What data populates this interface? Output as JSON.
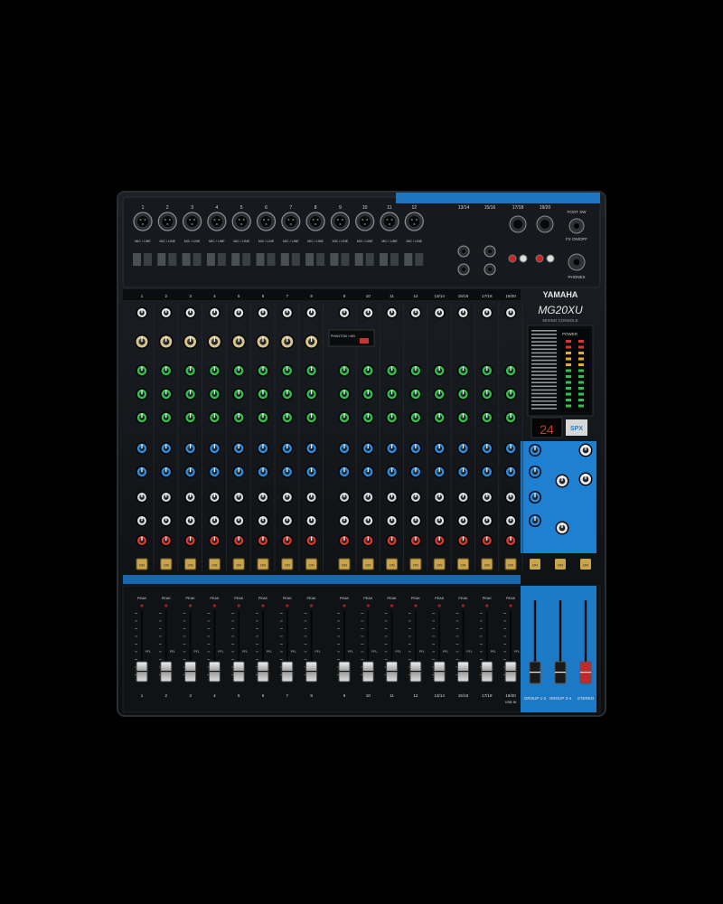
{
  "brand": "YAMAHA",
  "model": "MG20XU",
  "model_sub": "MIXING CONSOLE",
  "colors": {
    "background": "#000000",
    "body": "#111417",
    "accent_blue": "#1f7fd0",
    "knob_green": "#2ec24a",
    "knob_blue": "#2a8de0",
    "knob_red": "#e23a2a",
    "knob_cream": "#d9c48a",
    "on_button": "#c9a44a"
  },
  "top_labels": [
    "1",
    "2",
    "3",
    "4",
    "5",
    "6",
    "7",
    "8",
    "9",
    "10",
    "11",
    "12",
    "13/14",
    "15/16",
    "17/18",
    "19/20"
  ],
  "top_right": {
    "foot_sw": "FOOT SW",
    "fx_onoff": "FX ON/OFF",
    "phones": "PHONES"
  },
  "mic_line_label": "MIC / LINE",
  "channel_labels": [
    "1",
    "2",
    "3",
    "4",
    "5",
    "6",
    "7",
    "8",
    "9",
    "10",
    "11",
    "12",
    "13/14",
    "15/16",
    "17/18",
    "19/20"
  ],
  "phantom": "PHANTOM +48V",
  "on_label": "ON",
  "peak_label": "PEAK",
  "pfl_label": "PFL",
  "bottom_labels": [
    "1",
    "2",
    "3",
    "4",
    "5",
    "6",
    "7",
    "8",
    "9",
    "10",
    "11",
    "12",
    "13/14",
    "15/16",
    "17/18",
    "19/20",
    "GROUP 1-2",
    "GROUP 3-4",
    "STEREO"
  ],
  "usb_label": "USB IN",
  "fx_display": "24",
  "fx_logo": "SPX",
  "power_label": "POWER",
  "right_section_labels": [
    "GROUP 1-2",
    "GROUP 3-4",
    "STEREO"
  ]
}
